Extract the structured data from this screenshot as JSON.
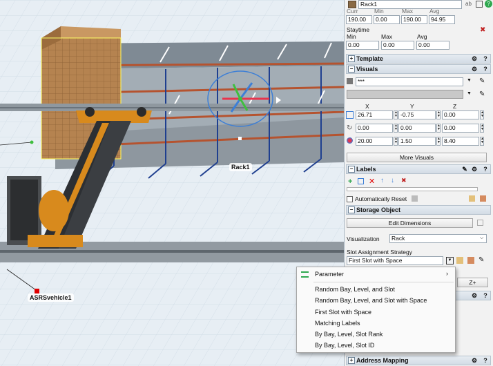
{
  "viewport": {
    "rack_label": "Rack1",
    "vehicle_label": "ASRSvehicle1"
  },
  "props": {
    "object_name": "Rack1",
    "stats": {
      "headers": [
        "Curr",
        "Min",
        "Max",
        "Avg"
      ],
      "values": [
        "190.00",
        "0.00",
        "190.00",
        "94.95"
      ]
    },
    "staytime": {
      "title": "Staytime",
      "headers": [
        "Min",
        "Max",
        "Avg"
      ],
      "values": [
        "0.00",
        "0.00",
        "0.00"
      ]
    },
    "sections": {
      "template": "Template",
      "visuals": "Visuals",
      "labels": "Labels",
      "storage": "Storage Object",
      "address": "Address Mapping"
    },
    "visuals": {
      "shape_value": "***",
      "axes": [
        "X",
        "Y",
        "Z"
      ],
      "position": [
        "26.71",
        "-0.75",
        "0.00"
      ],
      "rotation": [
        "0.00",
        "0.00",
        "0.00"
      ],
      "size": [
        "20.00",
        "1.50",
        "8.40"
      ],
      "more_button": "More Visuals"
    },
    "labels": {
      "auto_reset": "Automatically Reset"
    },
    "storage": {
      "edit_button": "Edit Dimensions",
      "visualization_label": "Visualization",
      "visualization_value": "Rack",
      "slot_strategy_label": "Slot Assignment Strategy",
      "slot_strategy_value": "First Slot with Space",
      "hidden_button": "Z+"
    }
  },
  "context_menu": {
    "header": "Parameter",
    "items": [
      "Random Bay, Level, and Slot",
      "Random Bay, Level, and Slot with Space",
      "First Slot with Space",
      "Matching Labels",
      "By Bay, Level, Slot Rank",
      "By Bay, Level, Slot ID"
    ]
  },
  "colors": {
    "rack_frame": "#1f3f8f",
    "beam": "#b5532f",
    "vehicle": "#d88a1d",
    "grid": "#c8d5e0",
    "box": "#b58350"
  }
}
